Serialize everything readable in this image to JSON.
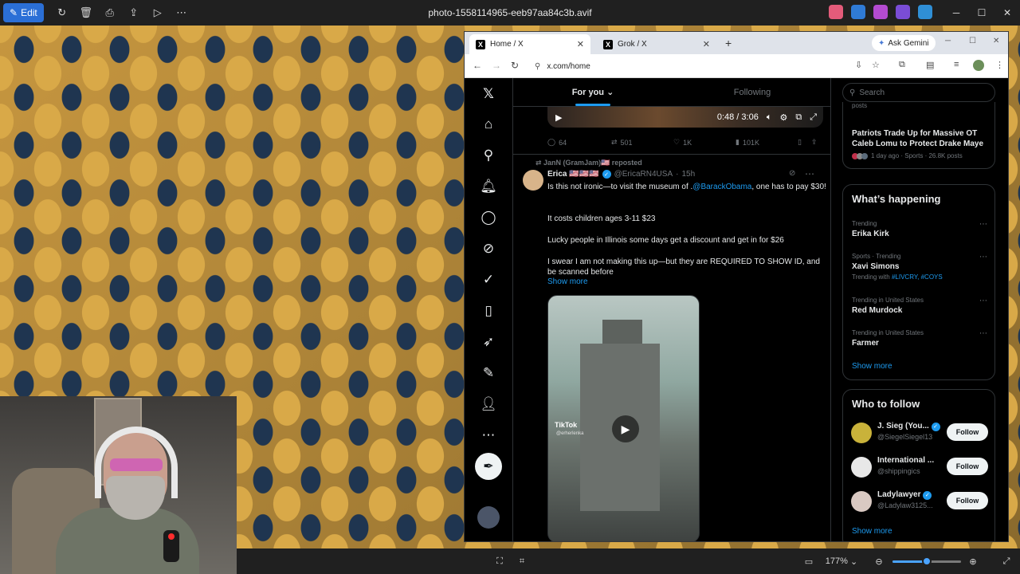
{
  "viewer": {
    "edit_label": "Edit",
    "file_name": "photo-1558114965-eeb97aa84c3b.avif",
    "zoom_label": "177%",
    "zoom_level": 0.5
  },
  "browser": {
    "tabs": [
      {
        "label": "Home / X",
        "active": true
      },
      {
        "label": "Grok / X",
        "active": false
      }
    ],
    "gemini_label": "Ask Gemini",
    "url": "x.com/home"
  },
  "x": {
    "feed_tabs": [
      "For you",
      "Following"
    ],
    "video1": {
      "time": "0:48 / 3:06"
    },
    "post1_actions": {
      "replies": "64",
      "reposts": "501",
      "likes": "1K",
      "views": "101K"
    },
    "post2": {
      "repost_by": "JanN (GramJam)🇺🇸 reposted",
      "name": "Erica 🇺🇸🇺🇸🇺🇸",
      "handle": "@EricaRN4USA",
      "time": "15h",
      "text1_a": "Is this not ironic—to visit the museum of .",
      "mention": "@BarackObama",
      "text1_b": ", one has to pay $30!",
      "text2": "It costs children ages 3-11 $23",
      "text3": "Lucky people in Illinois some days get a discount and get in for $26",
      "text4": "I swear I am not making this up—but they are REQUIRED TO SHOW ID, and be scanned before",
      "show_more": "Show more",
      "tiktok": "TikTok",
      "tiktok_user": "@erherlenka"
    },
    "sidebar": {
      "search_placeholder": "Search",
      "top_card": {
        "prev_text": "posts",
        "headline": "Patriots Trade Up for Massive OT Caleb Lomu to Protect Drake Maye",
        "meta": "1 day ago · Sports · 26.8K posts"
      },
      "whats_happening": {
        "title": "What’s happening",
        "items": [
          {
            "context": "Trending",
            "name": "Erika Kirk",
            "sub": ""
          },
          {
            "context": "Sports · Trending",
            "name": "Xavi Simons",
            "sub_prefix": "Trending with",
            "sub_tags": "#LIVCRY, #COYS"
          },
          {
            "context": "Trending in United States",
            "name": "Red Murdock",
            "sub": ""
          },
          {
            "context": "Trending in United States",
            "name": "Farmer",
            "sub": ""
          }
        ],
        "show_more": "Show more"
      },
      "who_to_follow": {
        "title": "Who to follow",
        "items": [
          {
            "name": "J. Sieg (You...",
            "handle": "@SiegelSiegel13",
            "button": "Follow"
          },
          {
            "name": "International ...",
            "handle": "@shippingics",
            "button": "Follow"
          },
          {
            "name": "Ladylawyer",
            "handle": "@Ladylaw3125...",
            "button": "Follow"
          }
        ],
        "show_more": "Show more"
      }
    }
  },
  "colors": {
    "accent": "#1d9bf0",
    "edit_button": "#2b6fd6",
    "background": "#000000"
  }
}
